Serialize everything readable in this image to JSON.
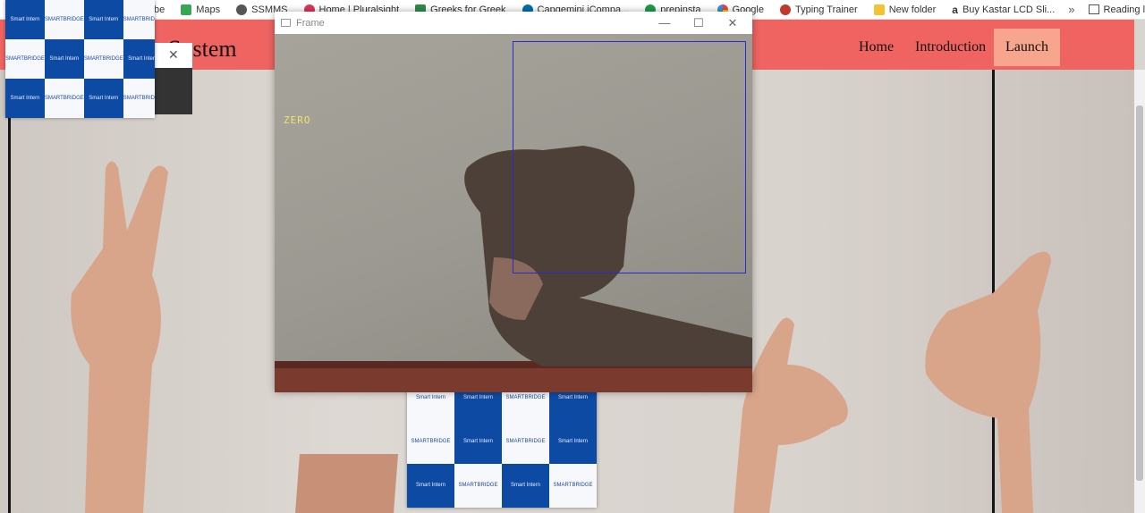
{
  "bookmarks": {
    "items": [
      {
        "label": "be",
        "icon": "youtube-icon",
        "color": "#ff0000"
      },
      {
        "label": "Maps",
        "icon": "maps-icon",
        "color": "#34a853"
      },
      {
        "label": "SSMMS",
        "icon": "globe-icon",
        "color": "#555555"
      },
      {
        "label": "Home | Pluralsight",
        "icon": "pluralsight-icon",
        "color": "#e2315a"
      },
      {
        "label": "Greeks for Greek",
        "icon": "gfg-icon",
        "color": "#2f8d46"
      },
      {
        "label": "Capgemini iCompa...",
        "icon": "capgemini-icon",
        "color": "#0070ad"
      },
      {
        "label": "prepinsta",
        "icon": "prepinsta-icon",
        "color": "#1a9e4a"
      },
      {
        "label": "Google",
        "icon": "google-icon",
        "color": "#4285f4"
      },
      {
        "label": "Typing Trainer",
        "icon": "typing-trainer-icon",
        "color": "#c0392b"
      },
      {
        "label": "New folder",
        "icon": "folder-icon",
        "color": "#f4c430"
      },
      {
        "label": "Buy Kastar LCD Sli...",
        "icon": "amazon-icon",
        "color": "#222222"
      }
    ],
    "overflow": "»",
    "reading_list": "Reading list"
  },
  "site": {
    "title": "e System",
    "nav": [
      "Home",
      "Introduction",
      "Launch"
    ],
    "colors": {
      "navbar": "#ef6461",
      "active": "#f7a58c"
    }
  },
  "small_dialog": {
    "close": "✕"
  },
  "frame_window": {
    "title": "Frame",
    "controls": {
      "minimize": "—",
      "maximize": "☐",
      "close": "✕"
    },
    "prediction": "ZERO"
  },
  "checker_text": {
    "a": "Smart Intern",
    "b": "SMARTBRIDGE"
  }
}
